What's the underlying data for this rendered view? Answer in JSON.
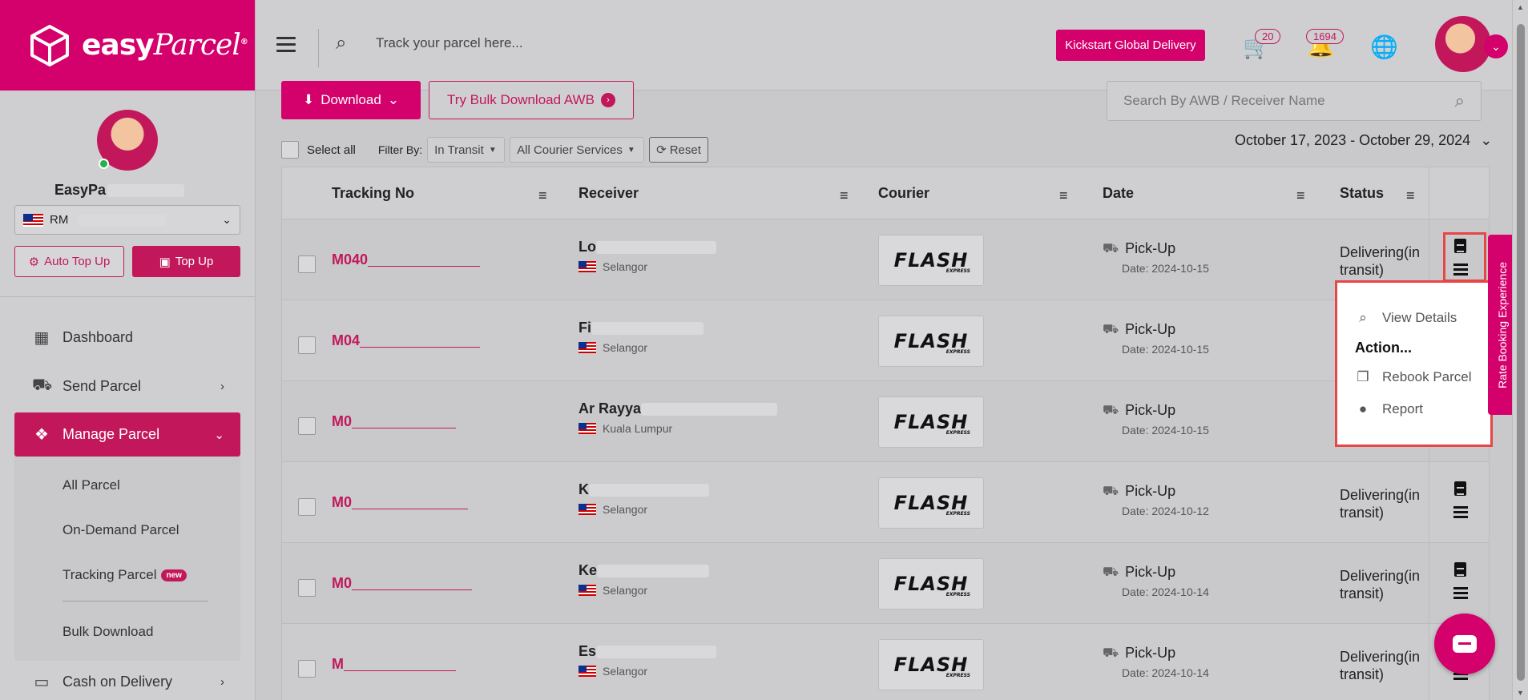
{
  "brand": {
    "logo_text": "easy",
    "logo_italic": "Parcel",
    "reg": "®"
  },
  "sidebar": {
    "user_name": "EasyPa",
    "currency": "RM",
    "auto_topup": "Auto Top Up",
    "topup": "Top Up",
    "nav": [
      {
        "label": "Dashboard",
        "icon": "dashboard-icon"
      },
      {
        "label": "Send Parcel",
        "icon": "truck-icon"
      },
      {
        "label": "Manage Parcel",
        "icon": "boxes-icon"
      }
    ],
    "subnav": [
      "All Parcel",
      "On-Demand Parcel",
      "Tracking Parcel",
      "Bulk Download"
    ],
    "badge_new": "new",
    "cash_on_delivery": "Cash on Delivery"
  },
  "header": {
    "search_placeholder": "Track your parcel here...",
    "kickstart": "Kickstart Global Delivery",
    "cart_count": "20",
    "notif_count": "1694"
  },
  "toolbar": {
    "download": "Download",
    "bulk_awb": "Try Bulk Download AWB",
    "awb_search_placeholder": "Search By AWB / Receiver Name",
    "select_all": "Select all",
    "filter_by": "Filter By:",
    "filter_status": "In Transit",
    "filter_courier": "All Courier Services",
    "reset": "Reset",
    "date_range": "October 17, 2023 - October 29, 2024"
  },
  "table": {
    "headers": {
      "tracking": "Tracking No",
      "receiver": "Receiver",
      "courier": "Courier",
      "date": "Date",
      "status": "Status"
    },
    "rows": [
      {
        "tracking": "M040",
        "receiver": "Lo",
        "state": "Selangor",
        "pickup": "Pick-Up",
        "date": "Date: 2024-10-15",
        "status": "Delivering(in transit)"
      },
      {
        "tracking": "M04",
        "receiver": "Fi",
        "state": "Selangor",
        "pickup": "Pick-Up",
        "date": "Date: 2024-10-15",
        "status": ""
      },
      {
        "tracking": "M0",
        "receiver": "Ar Rayya",
        "state": "Kuala Lumpur",
        "pickup": "Pick-Up",
        "date": "Date: 2024-10-15",
        "status": ""
      },
      {
        "tracking": "M0",
        "receiver": "K",
        "state": "Selangor",
        "pickup": "Pick-Up",
        "date": "Date: 2024-10-12",
        "status": "Delivering(in transit)"
      },
      {
        "tracking": "M0",
        "receiver": "Ke",
        "state": "Selangor",
        "pickup": "Pick-Up",
        "date": "Date: 2024-10-14",
        "status": "Delivering(in transit)"
      },
      {
        "tracking": "M",
        "receiver": "Es",
        "state": "Selangor",
        "pickup": "Pick-Up",
        "date": "Date: 2024-10-14",
        "status": "Delivering(in transit)"
      }
    ],
    "courier_name": "FLASH",
    "courier_sub": "EXPRESS"
  },
  "popup": {
    "view_details": "View Details",
    "action_label": "Action...",
    "rebook": "Rebook Parcel",
    "report": "Report"
  },
  "rate_tab": "Rate Booking Experience",
  "colors": {
    "brand": "#d4006b",
    "highlight": "#e84545"
  }
}
